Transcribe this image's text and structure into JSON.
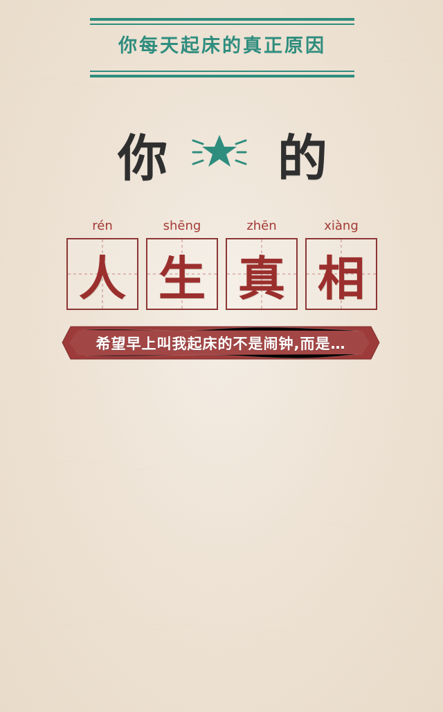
{
  "header": {
    "title": "你每天起床的真正原因"
  },
  "hero": {
    "left_char": "你",
    "right_char": "的",
    "icon": "star-icon",
    "pinyin": [
      "rén",
      "shēng",
      "zhēn",
      "xiàng"
    ],
    "chars": [
      "人",
      "生",
      "真",
      "相"
    ],
    "ribbon_text": "希望早上叫我起床的不是闹钟,而是…"
  },
  "colors": {
    "teal": "#2f8d7e",
    "red": "#9b2f2d",
    "dark": "#2f2f2f",
    "paper": "#efe4d6"
  }
}
